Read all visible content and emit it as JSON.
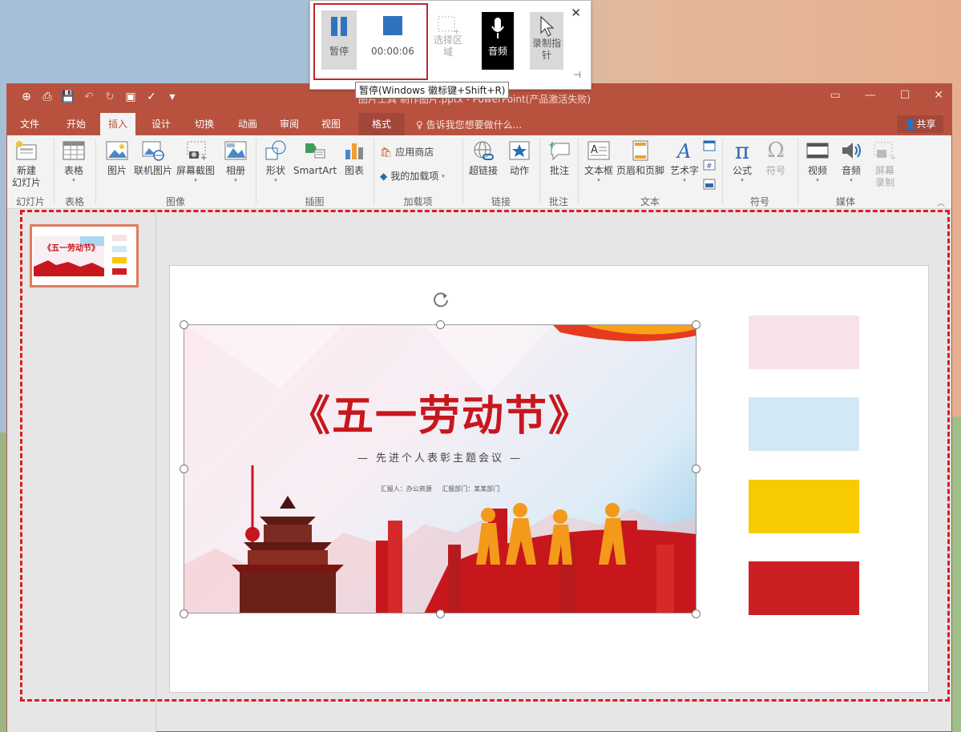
{
  "window": {
    "doc_title": "图片工具    制作图片.pptx - PowerPoint(产品激活失败)"
  },
  "ribbon_tabs": [
    {
      "label": "文件"
    },
    {
      "label": "开始"
    },
    {
      "label": "插入"
    },
    {
      "label": "设计"
    },
    {
      "label": "切换"
    },
    {
      "label": "动画"
    },
    {
      "label": "审阅"
    },
    {
      "label": "视图"
    },
    {
      "label": "格式"
    }
  ],
  "tell_me": "告诉我您想要做什么...",
  "share": "共享",
  "ribbon": {
    "new_slide_1": "新建",
    "new_slide_2": "幻灯片",
    "table": "表格",
    "picture": "图片",
    "online_picture": "联机图片",
    "screenshot": "屏幕截图",
    "album": "相册",
    "shapes": "形状",
    "smartart": "SmartArt",
    "chart": "图表",
    "store": "应用商店",
    "my_addins": "我的加载项",
    "hyperlink": "超链接",
    "action": "动作",
    "comment": "批注",
    "textbox": "文本框",
    "header_footer": "页眉和页脚",
    "wordart": "艺术字",
    "equation": "公式",
    "symbol": "符号",
    "video": "视频",
    "audio": "音频",
    "screen_rec_1": "屏幕",
    "screen_rec_2": "录制",
    "groups": {
      "slides": "幻灯片",
      "tables": "表格",
      "images": "图像",
      "illustrations": "插图",
      "addins": "加载项",
      "links": "链接",
      "comments": "批注",
      "text": "文本",
      "symbols": "符号",
      "media": "媒体"
    }
  },
  "recorder": {
    "pause": "暂停",
    "timer": "00:00:06",
    "select_area_1": "选择区",
    "select_area_2": "域",
    "audio": "音频",
    "record_pointer_1": "录制指",
    "record_pointer_2": "针",
    "tooltip": "暂停(Windows 徽标键+Shift+R)"
  },
  "slide_picture": {
    "title": "《五一劳动节》",
    "subtitle": "— 先进个人表彰主题会议 —",
    "meta": "汇报人：办公资源 汇报部门：某某部门"
  },
  "swatches": [
    {
      "color": "#f8e2ea"
    },
    {
      "color": "#d2e8f5"
    },
    {
      "color": "#f7cb00"
    },
    {
      "color": "#cc1f24"
    }
  ],
  "colors": {
    "accent": "#b8523f",
    "selection_dash": "#e01b1b",
    "recorder_highlight": "#c0262c"
  }
}
